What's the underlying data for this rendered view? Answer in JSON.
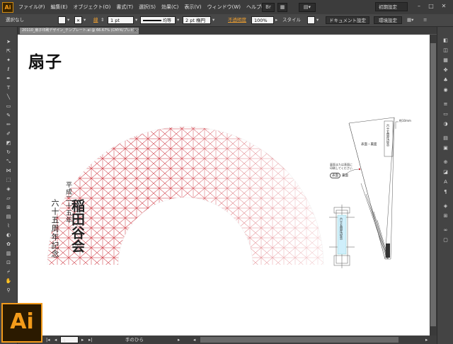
{
  "menubar": {
    "logo": "Ai",
    "items": [
      "ファイル(F)",
      "編集(E)",
      "オブジェクト(O)",
      "書式(T)",
      "選択(S)",
      "効果(C)",
      "表示(V)",
      "ウィンドウ(W)",
      "ヘルプ(H)"
    ],
    "workspace": "初期設定"
  },
  "control": {
    "selection": "選択なし",
    "stroke_label": "線",
    "stroke_width": "1 pt",
    "profile": "均等",
    "brush": "2 pt 楕円",
    "opacity_label": "不透明度",
    "opacity_value": "100%",
    "style_label": "スタイル",
    "doc_setup": "ドキュメント設定",
    "preferences": "環境設定"
  },
  "document": {
    "tab_title": "20110_扇子印刷デザイン_テンプレート.ai @ 66.67% (CMYK/プレビュー)",
    "artboard_title": "扇子",
    "fan_text_1": "平成二十五年",
    "fan_text_2": "稲田谷会",
    "fan_text_3": "六十五周年記念",
    "diagram_sleeve": "六十五周年記念",
    "diagram_note_top": "約10mm",
    "diagram_label_a": "表面・裏面",
    "diagram_note_b": "裏面または表面に印刷してください",
    "diagram_label_c": "表面",
    "diagram_label_d": "裏面"
  },
  "status": {
    "page": "1",
    "tool": "手のひら"
  },
  "app_icon": "Ai",
  "colors": {
    "pattern_red": "#cc2a35",
    "accent_orange": "#f39b1a"
  }
}
